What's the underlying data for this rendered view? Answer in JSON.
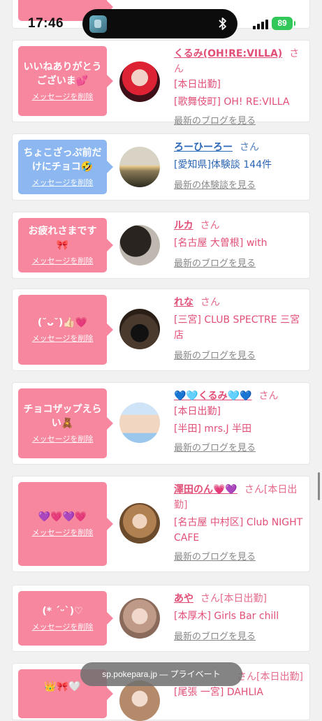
{
  "status": {
    "time": "17:46",
    "battery": "89"
  },
  "url": {
    "text": "sp.pokepara.jp — プライベート"
  },
  "common": {
    "delete_label": "メッセージを削除",
    "san": "さん"
  },
  "cards": [
    {
      "bubble_text": "いいねありがとうございま💕",
      "name": "くるみ(OH!RE:VILLA)",
      "suffix": "",
      "lines": [
        "[本日出勤]",
        "[歌舞伎町] OH! RE:VILLA"
      ],
      "link": "最新のブログを見る"
    },
    {
      "bubble_text": "ちょこざっぷ前だけにチョコ🤣",
      "name": "ろーひーろー",
      "suffix": "",
      "lines": [
        "[愛知県]体験談 144件"
      ],
      "link": "最新の体験談を見る"
    },
    {
      "bubble_text": "お疲れさまです🎀",
      "name": "ルカ",
      "suffix": "",
      "lines": [
        "[名古屋 大曽根] with"
      ],
      "link": "最新のブログを見る"
    },
    {
      "bubble_text": "(˘ᴗ˘)👍🏻💗",
      "name": "れな",
      "suffix": "",
      "lines": [
        "[三宮] CLUB SPECTRE 三宮店"
      ],
      "link": "最新のブログを見る"
    },
    {
      "bubble_text": "チョコザップえらい🧸",
      "name": "💙🩵くるみ🩵💙",
      "suffix": "",
      "lines": [
        "[本日出勤]",
        "[半田] mrs.J 半田"
      ],
      "link": "最新のブログを見る"
    },
    {
      "bubble_text": "💜💗💜💗",
      "name": "澤田のん💗💜",
      "suffix": "[本日出勤]",
      "lines": [
        "[名古屋 中村区] Club NIGHT CAFE"
      ],
      "link": "最新のブログを見る"
    },
    {
      "bubble_text": "(* ˊᵕˋ)♡",
      "name": "あや",
      "suffix": "[本日出勤]",
      "lines": [
        "[本厚木] Girls Bar chill"
      ],
      "link": "最新のブログを見る"
    },
    {
      "bubble_text": "👑🎀🤍",
      "name": "",
      "suffix": "[本日出勤]",
      "lines": [
        "[尾張 一宮] DAHLIA"
      ],
      "link": ""
    }
  ]
}
